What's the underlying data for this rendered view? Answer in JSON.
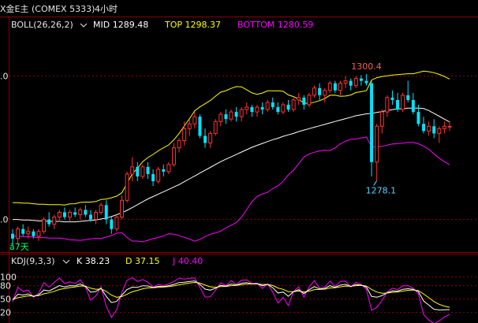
{
  "header": {
    "symbol": "X金E主 (COMEX 5333)",
    "period": "4小时"
  },
  "boll": {
    "name": "BOLL(26,26,2)",
    "mid_label": "MID 1289.48",
    "top_label": "TOP 1298.37",
    "bottom_label": "BOTTOM 1280.59",
    "colors": {
      "mid": "#ffffff",
      "top": "#ffff00",
      "bottom": "#ff00ff"
    }
  },
  "price_axis": {
    "ticks": [
      {
        "label": ".0",
        "value": 1300
      },
      {
        "label": ".0",
        "value": 1270
      }
    ],
    "ylim": [
      1263.5,
      1309.0
    ]
  },
  "annotations": {
    "high": {
      "label": "1300.4",
      "index": 68
    },
    "low": {
      "label": "1278.1",
      "index": 70
    },
    "days": "ӑ7天"
  },
  "kdj": {
    "name": "KDJ(9,3,3)",
    "k_label": "K 38.23",
    "d_label": "D 37.15",
    "j_label": "J 40.40",
    "ticks": [
      "100",
      "80",
      "50",
      "20"
    ],
    "ylim": [
      0,
      120
    ],
    "colors": {
      "k": "#ffffff",
      "d": "#ffff00",
      "j": "#ff00ff"
    }
  },
  "colors": {
    "up": "#ff3232",
    "down": "#00e4ff",
    "grid": "#8b0000"
  },
  "chart_data": {
    "type": "candlestick",
    "candles": [
      [
        1267.0,
        1268.0,
        1264.5,
        1266.0
      ],
      [
        1266.0,
        1268.5,
        1265.0,
        1268.0
      ],
      [
        1268.0,
        1269.0,
        1266.5,
        1267.0
      ],
      [
        1267.0,
        1268.5,
        1266.0,
        1267.5
      ],
      [
        1267.5,
        1268.0,
        1266.0,
        1266.5
      ],
      [
        1266.5,
        1268.0,
        1265.5,
        1267.5
      ],
      [
        1267.5,
        1270.5,
        1267.0,
        1270.0
      ],
      [
        1270.0,
        1271.5,
        1268.5,
        1269.0
      ],
      [
        1269.0,
        1271.0,
        1268.0,
        1270.5
      ],
      [
        1270.5,
        1272.0,
        1269.5,
        1271.5
      ],
      [
        1271.5,
        1272.5,
        1270.0,
        1270.5
      ],
      [
        1270.5,
        1272.0,
        1269.5,
        1271.5
      ],
      [
        1271.5,
        1272.5,
        1270.5,
        1271.0
      ],
      [
        1271.0,
        1272.5,
        1270.0,
        1272.0
      ],
      [
        1272.0,
        1273.0,
        1270.5,
        1271.0
      ],
      [
        1271.0,
        1272.0,
        1269.5,
        1270.0
      ],
      [
        1270.0,
        1272.0,
        1269.0,
        1271.5
      ],
      [
        1271.5,
        1273.5,
        1271.0,
        1273.0
      ],
      [
        1273.0,
        1274.0,
        1269.0,
        1270.0
      ],
      [
        1270.0,
        1270.5,
        1267.0,
        1268.0
      ],
      [
        1268.0,
        1271.0,
        1267.5,
        1270.5
      ],
      [
        1270.5,
        1275.0,
        1270.0,
        1274.0
      ],
      [
        1274.0,
        1280.0,
        1273.5,
        1279.5
      ],
      [
        1279.5,
        1283.0,
        1278.0,
        1281.0
      ],
      [
        1281.0,
        1282.0,
        1278.0,
        1279.0
      ],
      [
        1279.0,
        1281.5,
        1278.5,
        1281.0
      ],
      [
        1281.0,
        1282.0,
        1278.5,
        1279.5
      ],
      [
        1279.5,
        1280.5,
        1277.0,
        1278.0
      ],
      [
        1278.0,
        1281.0,
        1277.5,
        1280.5
      ],
      [
        1280.5,
        1281.5,
        1279.0,
        1280.0
      ],
      [
        1280.0,
        1282.0,
        1279.5,
        1281.5
      ],
      [
        1281.5,
        1286.0,
        1281.0,
        1285.0
      ],
      [
        1285.0,
        1287.0,
        1284.0,
        1286.5
      ],
      [
        1286.5,
        1290.5,
        1285.5,
        1289.0
      ],
      [
        1289.0,
        1291.0,
        1287.5,
        1290.0
      ],
      [
        1290.0,
        1292.5,
        1289.0,
        1291.5
      ],
      [
        1291.5,
        1292.0,
        1287.0,
        1287.5
      ],
      [
        1287.5,
        1289.0,
        1285.0,
        1286.0
      ],
      [
        1286.0,
        1288.5,
        1285.0,
        1288.0
      ],
      [
        1288.0,
        1291.0,
        1287.5,
        1290.5
      ],
      [
        1290.5,
        1292.5,
        1289.5,
        1292.0
      ],
      [
        1292.0,
        1293.0,
        1290.0,
        1291.0
      ],
      [
        1291.0,
        1293.0,
        1290.5,
        1292.5
      ],
      [
        1292.5,
        1293.5,
        1290.5,
        1291.5
      ],
      [
        1291.5,
        1293.5,
        1290.5,
        1293.0
      ],
      [
        1293.0,
        1294.5,
        1292.0,
        1293.5
      ],
      [
        1293.5,
        1294.0,
        1291.5,
        1292.5
      ],
      [
        1292.5,
        1294.0,
        1291.5,
        1293.5
      ],
      [
        1293.5,
        1294.5,
        1292.0,
        1293.0
      ],
      [
        1293.0,
        1295.0,
        1292.5,
        1294.5
      ],
      [
        1294.5,
        1295.5,
        1293.0,
        1293.5
      ],
      [
        1293.5,
        1294.5,
        1292.0,
        1292.5
      ],
      [
        1292.5,
        1294.5,
        1292.0,
        1294.0
      ],
      [
        1294.0,
        1295.0,
        1292.5,
        1293.0
      ],
      [
        1293.0,
        1295.5,
        1292.5,
        1295.0
      ],
      [
        1295.0,
        1296.5,
        1294.0,
        1295.5
      ],
      [
        1295.5,
        1296.0,
        1293.0,
        1294.0
      ],
      [
        1294.0,
        1296.5,
        1293.5,
        1296.0
      ],
      [
        1296.0,
        1298.0,
        1295.5,
        1297.5
      ],
      [
        1297.5,
        1298.5,
        1295.0,
        1296.0
      ],
      [
        1296.0,
        1297.5,
        1294.5,
        1297.0
      ],
      [
        1297.0,
        1299.0,
        1296.5,
        1298.5
      ],
      [
        1298.5,
        1299.0,
        1296.5,
        1297.0
      ],
      [
        1297.0,
        1299.0,
        1296.0,
        1298.5
      ],
      [
        1298.5,
        1300.0,
        1297.5,
        1299.0
      ],
      [
        1299.0,
        1299.5,
        1297.0,
        1298.0
      ],
      [
        1298.0,
        1300.0,
        1297.5,
        1299.5
      ],
      [
        1299.5,
        1300.2,
        1298.0,
        1299.0
      ],
      [
        1299.0,
        1300.4,
        1298.0,
        1298.5
      ],
      [
        1298.5,
        1299.0,
        1279.0,
        1282.0
      ],
      [
        1282.0,
        1290.0,
        1278.1,
        1289.5
      ],
      [
        1289.5,
        1293.0,
        1288.0,
        1292.5
      ],
      [
        1292.5,
        1296.0,
        1291.5,
        1295.5
      ],
      [
        1295.5,
        1297.0,
        1294.0,
        1295.0
      ],
      [
        1295.0,
        1296.5,
        1292.5,
        1293.0
      ],
      [
        1293.0,
        1296.5,
        1292.5,
        1296.0
      ],
      [
        1296.0,
        1299.0,
        1294.5,
        1295.0
      ],
      [
        1295.0,
        1296.5,
        1292.0,
        1292.5
      ],
      [
        1292.5,
        1294.0,
        1289.5,
        1290.0
      ],
      [
        1290.0,
        1291.5,
        1288.0,
        1288.5
      ],
      [
        1288.5,
        1290.5,
        1287.5,
        1289.5
      ],
      [
        1289.5,
        1291.0,
        1287.0,
        1288.0
      ],
      [
        1288.0,
        1289.5,
        1286.0,
        1289.0
      ],
      [
        1289.0,
        1290.5,
        1288.0,
        1289.5
      ],
      [
        1289.5,
        1290.5,
        1288.5,
        1289.5
      ]
    ],
    "boll_mid": [
      1270.0,
      1270.0,
      1269.9,
      1269.9,
      1269.8,
      1269.7,
      1269.7,
      1269.6,
      1269.6,
      1269.6,
      1269.5,
      1269.5,
      1269.5,
      1269.6,
      1269.7,
      1269.8,
      1269.9,
      1270.1,
      1270.3,
      1270.6,
      1271.0,
      1271.4,
      1271.9,
      1272.5,
      1273.1,
      1273.7,
      1274.3,
      1274.8,
      1275.3,
      1275.8,
      1276.3,
      1276.8,
      1277.3,
      1277.9,
      1278.5,
      1279.1,
      1279.7,
      1280.3,
      1280.9,
      1281.5,
      1282.1,
      1282.6,
      1283.1,
      1283.6,
      1284.1,
      1284.6,
      1285.1,
      1285.5,
      1285.9,
      1286.3,
      1286.7,
      1287.0,
      1287.4,
      1287.7,
      1288.0,
      1288.4,
      1288.7,
      1289.0,
      1289.3,
      1289.6,
      1289.9,
      1290.2,
      1290.5,
      1290.8,
      1291.1,
      1291.4,
      1291.7,
      1291.9,
      1292.1,
      1292.2,
      1292.4,
      1292.6,
      1292.8,
      1293.0,
      1293.1,
      1293.2,
      1293.3,
      1293.3,
      1293.3,
      1293.2,
      1292.8,
      1292.2,
      1291.6,
      1291.0,
      1290.4
    ]
  }
}
